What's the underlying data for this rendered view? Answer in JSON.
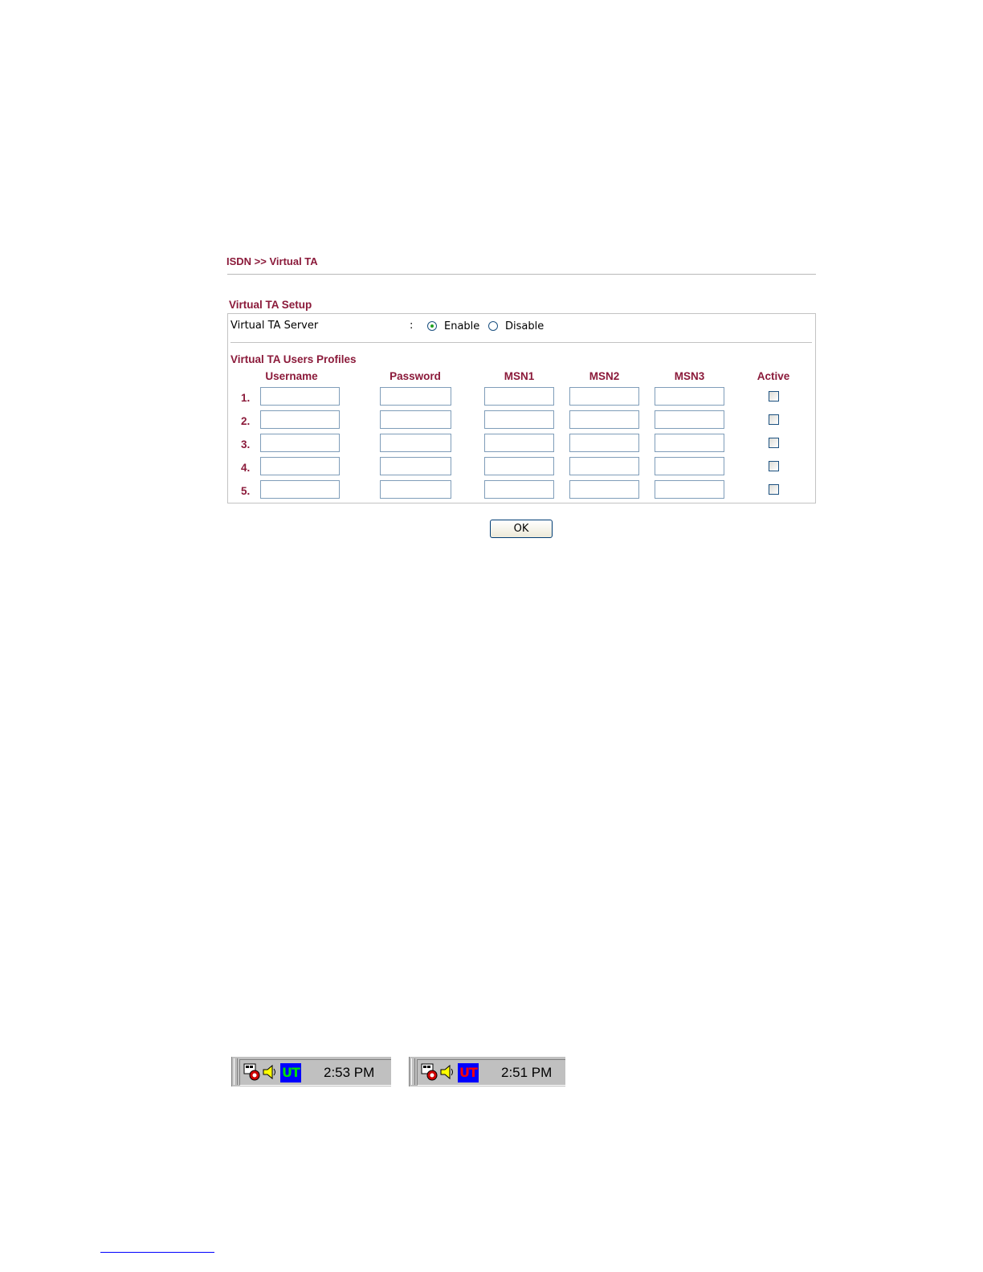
{
  "breadcrumb": "ISDN >> Virtual TA",
  "setup": {
    "title": "Virtual TA Setup",
    "server_label": "Virtual TA Server",
    "colon": ":",
    "enable_label": "Enable",
    "disable_label": "Disable",
    "selected": "Enable"
  },
  "profiles": {
    "title": "Virtual TA Users Profiles",
    "headers": {
      "username": "Username",
      "password": "Password",
      "msn1": "MSN1",
      "msn2": "MSN2",
      "msn3": "MSN3",
      "active": "Active"
    },
    "rows": [
      {
        "num": "1.",
        "username": "",
        "password": "",
        "msn1": "",
        "msn2": "",
        "msn3": "",
        "active": false
      },
      {
        "num": "2.",
        "username": "",
        "password": "",
        "msn1": "",
        "msn2": "",
        "msn3": "",
        "active": false
      },
      {
        "num": "3.",
        "username": "",
        "password": "",
        "msn1": "",
        "msn2": "",
        "msn3": "",
        "active": false
      },
      {
        "num": "4.",
        "username": "",
        "password": "",
        "msn1": "",
        "msn2": "",
        "msn3": "",
        "active": false
      },
      {
        "num": "5.",
        "username": "",
        "password": "",
        "msn1": "",
        "msn2": "",
        "msn3": "",
        "active": false
      }
    ]
  },
  "ok_label": "OK",
  "trays": [
    {
      "ut_label": "UT",
      "ut_bg": "#0000ff",
      "ut_fg": "#00e000",
      "time": "2:53 PM"
    },
    {
      "ut_label": "UT",
      "ut_bg": "#0000ff",
      "ut_fg": "#ff0000",
      "time": "2:51 PM"
    }
  ],
  "colors": {
    "accent": "#8b1a3a",
    "input_border": "#7f9db9"
  }
}
